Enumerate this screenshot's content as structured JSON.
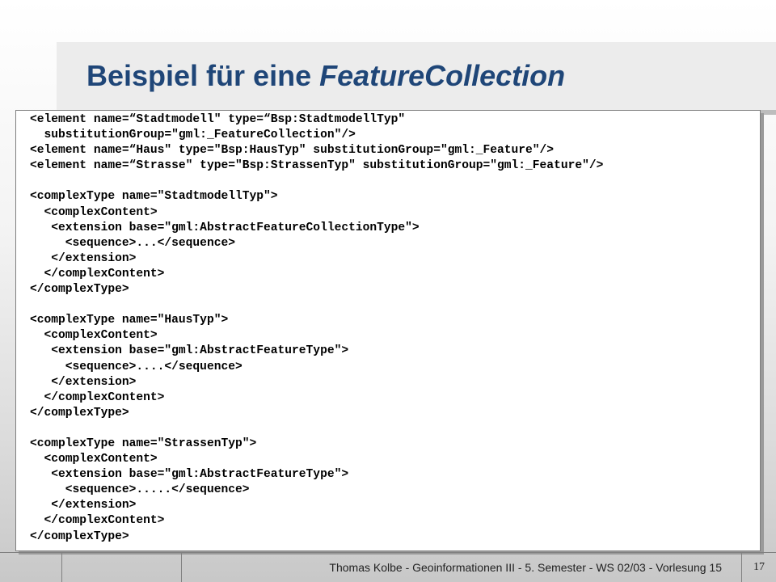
{
  "slide": {
    "title_prefix": "Beispiel für eine ",
    "title_emphasis": "FeatureCollection",
    "code_lines": [
      "<element name=“Stadtmodell\" type=“Bsp:StadtmodellTyp\"",
      "  substitutionGroup=\"gml:_FeatureCollection\"/>",
      "<element name=“Haus\" type=\"Bsp:HausTyp\" substitutionGroup=\"gml:_Feature\"/>",
      "<element name=“Strasse\" type=\"Bsp:StrassenTyp\" substitutionGroup=\"gml:_Feature\"/>",
      "",
      "<complexType name=\"StadtmodellTyp\">",
      "  <complexContent>",
      "   <extension base=\"gml:AbstractFeatureCollectionType\">",
      "     <sequence>...</sequence>",
      "   </extension>",
      "  </complexContent>",
      "</complexType>",
      "",
      "<complexType name=\"HausTyp\">",
      "  <complexContent>",
      "   <extension base=\"gml:AbstractFeatureType\">",
      "     <sequence>....</sequence>",
      "   </extension>",
      "  </complexContent>",
      "</complexType>",
      "",
      "<complexType name=\"StrassenTyp\">",
      "  <complexContent>",
      "   <extension base=\"gml:AbstractFeatureType\">",
      "     <sequence>.....</sequence>",
      "   </extension>",
      "  </complexContent>",
      "</complexType>"
    ]
  },
  "footer": {
    "text": "Thomas Kolbe  -  Geoinformationen III  -  5. Semester  -  WS 02/03  -  Vorlesung 15",
    "page_number": "17"
  },
  "colors": {
    "title": "#1f4678"
  }
}
